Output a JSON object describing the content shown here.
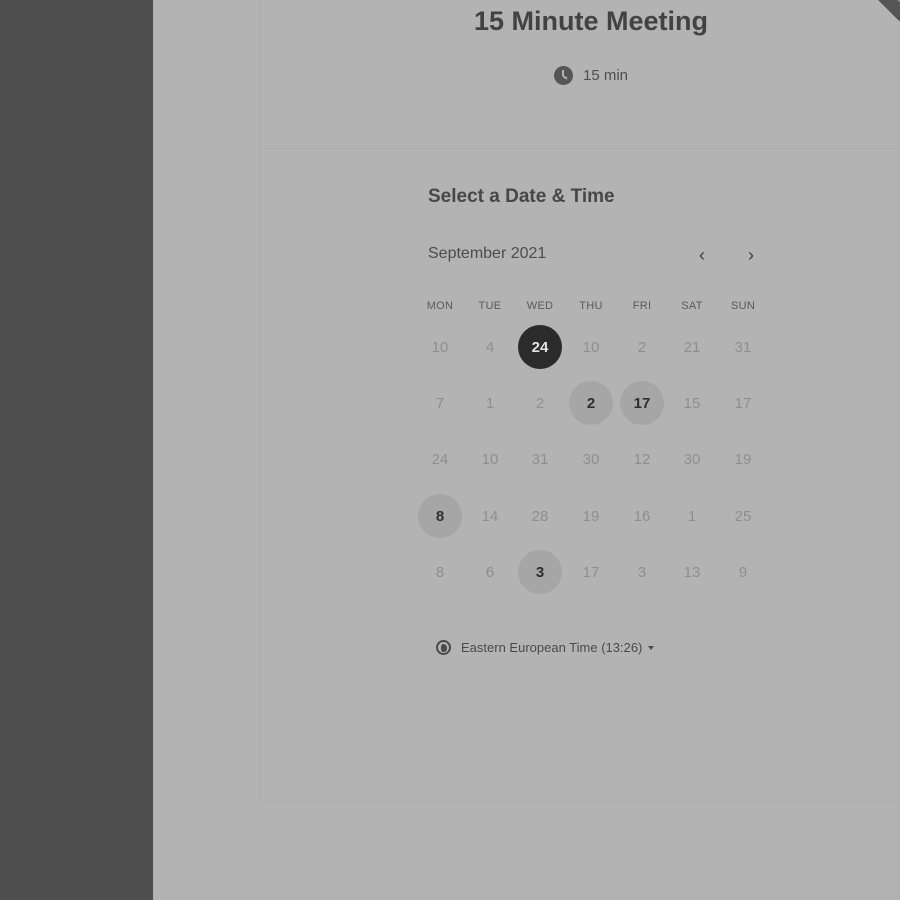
{
  "event": {
    "title": "15 Minute Meeting",
    "duration": "15 min"
  },
  "scheduler": {
    "heading": "Select a Date & Time",
    "month_label": "September 2021",
    "prev_icon": "chevron-left-icon",
    "next_icon": "chevron-right-icon",
    "weekdays": [
      "MON",
      "TUE",
      "WED",
      "THU",
      "FRI",
      "SAT",
      "SUN"
    ],
    "weeks": [
      [
        {
          "d": "10",
          "s": "disabled"
        },
        {
          "d": "4",
          "s": "disabled"
        },
        {
          "d": "24",
          "s": "selected"
        },
        {
          "d": "10",
          "s": "disabled"
        },
        {
          "d": "2",
          "s": "disabled"
        },
        {
          "d": "21",
          "s": "disabled"
        },
        {
          "d": "31",
          "s": "disabled"
        }
      ],
      [
        {
          "d": "7",
          "s": "disabled"
        },
        {
          "d": "1",
          "s": "disabled"
        },
        {
          "d": "2",
          "s": "disabled"
        },
        {
          "d": "2",
          "s": "available"
        },
        {
          "d": "17",
          "s": "available"
        },
        {
          "d": "15",
          "s": "disabled"
        },
        {
          "d": "17",
          "s": "disabled"
        }
      ],
      [
        {
          "d": "24",
          "s": "disabled"
        },
        {
          "d": "10",
          "s": "disabled"
        },
        {
          "d": "31",
          "s": "disabled"
        },
        {
          "d": "30",
          "s": "disabled"
        },
        {
          "d": "12",
          "s": "disabled"
        },
        {
          "d": "30",
          "s": "disabled"
        },
        {
          "d": "19",
          "s": "disabled"
        }
      ],
      [
        {
          "d": "8",
          "s": "available"
        },
        {
          "d": "14",
          "s": "disabled"
        },
        {
          "d": "28",
          "s": "disabled"
        },
        {
          "d": "19",
          "s": "disabled"
        },
        {
          "d": "16",
          "s": "disabled"
        },
        {
          "d": "1",
          "s": "disabled"
        },
        {
          "d": "25",
          "s": "disabled"
        }
      ],
      [
        {
          "d": "8",
          "s": "disabled"
        },
        {
          "d": "6",
          "s": "disabled"
        },
        {
          "d": "3",
          "s": "available"
        },
        {
          "d": "17",
          "s": "disabled"
        },
        {
          "d": "3",
          "s": "disabled"
        },
        {
          "d": "13",
          "s": "disabled"
        },
        {
          "d": "9",
          "s": "disabled"
        }
      ]
    ],
    "timezone": "Eastern European Time (13:26)"
  },
  "colors": {
    "sidebar": "#4d4d4d",
    "background": "#b3b3b3",
    "selected_day": "#2b2b2b",
    "available_day": "#a6a6a6"
  }
}
